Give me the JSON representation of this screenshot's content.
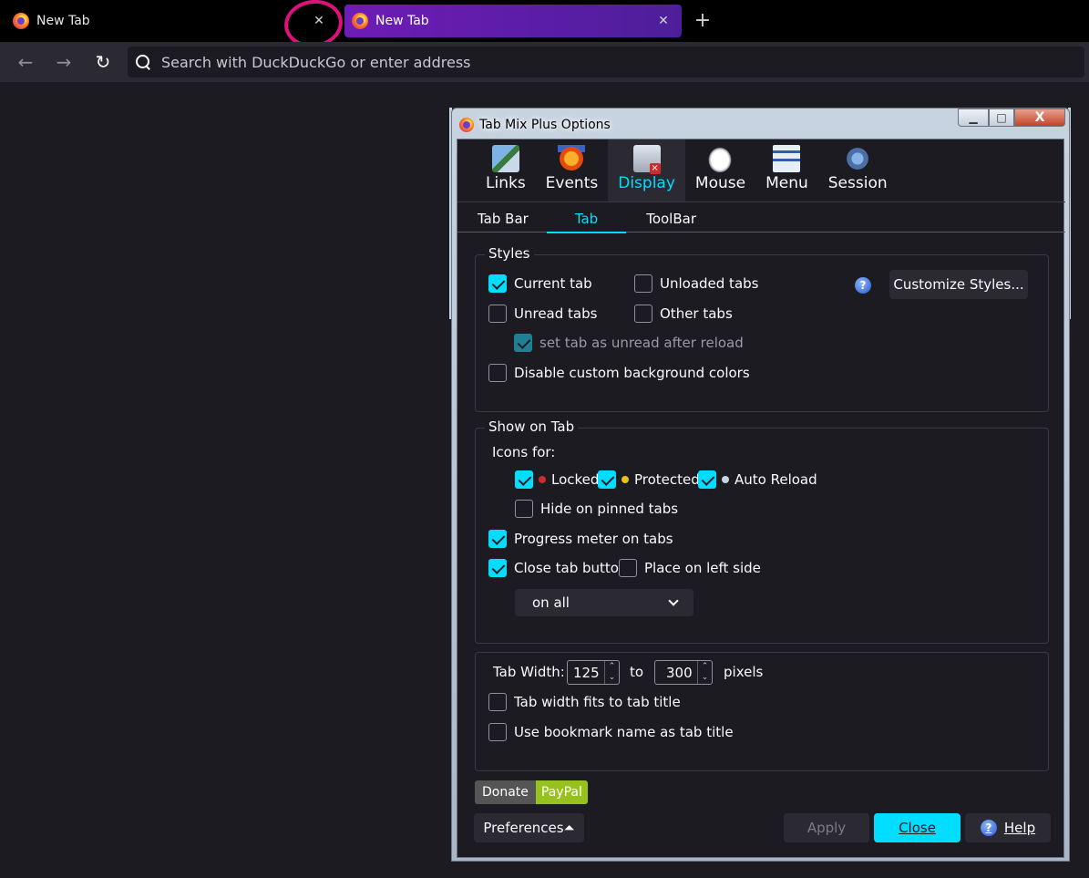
{
  "browser": {
    "tabs": [
      {
        "title": "New Tab",
        "close": "✕"
      },
      {
        "title": "New Tab",
        "close": "✕"
      }
    ],
    "new_tab": "+",
    "nav": {
      "back": "←",
      "forward": "→",
      "reload": "↻"
    },
    "url_placeholder": "Search with DuckDuckGo or enter address",
    "highlight_color": "#e0107a"
  },
  "dialog": {
    "title": "Tab Mix Plus Options",
    "window_buttons": {
      "minimize": "▁",
      "maximize": "□",
      "close": "X"
    },
    "main_tabs": [
      {
        "label": "Links",
        "icon": "links-icon"
      },
      {
        "label": "Events",
        "icon": "events-icon"
      },
      {
        "label": "Display",
        "icon": "display-icon"
      },
      {
        "label": "Mouse",
        "icon": "mouse-icon"
      },
      {
        "label": "Menu",
        "icon": "menu-icon"
      },
      {
        "label": "Session",
        "icon": "session-icon"
      }
    ],
    "active_main_tab": "Display",
    "sub_tabs": [
      "Tab Bar",
      "Tab",
      "ToolBar"
    ],
    "active_sub_tab": "Tab",
    "styles": {
      "caption": "Styles",
      "current_tab": {
        "label": "Current tab",
        "checked": true
      },
      "unloaded_tabs": {
        "label": "Unloaded tabs",
        "checked": false
      },
      "unread_tabs": {
        "label": "Unread tabs",
        "checked": false
      },
      "other_tabs": {
        "label": "Other tabs",
        "checked": false
      },
      "set_unread": {
        "label": "set tab as unread after reload",
        "checked": true,
        "disabled": true
      },
      "disable_bg": {
        "label": "Disable custom background colors",
        "checked": false
      },
      "help_icon": "?",
      "customize_button": "Customize Styles..."
    },
    "show_on_tab": {
      "caption": "Show on Tab",
      "icons_for": "Icons for:",
      "locked": {
        "label": "Locked",
        "checked": true
      },
      "protected": {
        "label": "Protected",
        "checked": true
      },
      "auto_reload": {
        "label": "Auto Reload",
        "checked": true
      },
      "hide_pinned": {
        "label": "Hide on pinned tabs",
        "checked": false
      },
      "progress_meter": {
        "label": "Progress meter on tabs",
        "checked": true
      },
      "close_button": {
        "label": "Close tab button",
        "checked": true
      },
      "place_left": {
        "label": "Place on left side",
        "checked": false
      },
      "close_button_select": "on all"
    },
    "tab_width": {
      "label": "Tab Width:",
      "min": "125",
      "to": "to",
      "max": "300",
      "unit": "pixels",
      "fits_title": {
        "label": "Tab width fits to tab title",
        "checked": false
      },
      "bookmark_name": {
        "label": "Use bookmark name as tab title",
        "checked": false
      }
    },
    "donate": {
      "label": "Donate",
      "paypal": "PayPal"
    },
    "buttons": {
      "preferences": "Preferences⏶",
      "apply": "Apply",
      "close": "Close",
      "help": "Help",
      "help_icon": "?"
    },
    "accent_color": "#00ddff"
  }
}
